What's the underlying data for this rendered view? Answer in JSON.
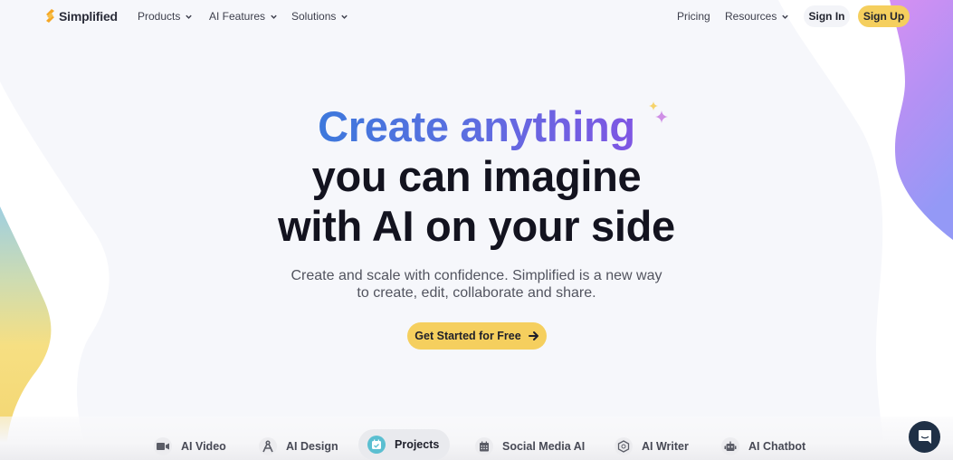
{
  "nav": {
    "logo_text": "Simplified",
    "menu": [
      {
        "label": "Products",
        "has_dropdown": true
      },
      {
        "label": "AI Features",
        "has_dropdown": true
      },
      {
        "label": "Solutions",
        "has_dropdown": true
      }
    ],
    "right_menu": [
      {
        "label": "Pricing",
        "has_dropdown": false
      },
      {
        "label": "Resources",
        "has_dropdown": true
      }
    ],
    "sign_in_label": "Sign In",
    "sign_up_label": "Sign Up"
  },
  "hero": {
    "headline_line1": "Create anything",
    "headline_line2": "you can imagine",
    "headline_line3": "with AI on your side",
    "subtitle_line1": "Create and scale with confidence. Simplified is a new way",
    "subtitle_line2": "to create, edit, collaborate and share.",
    "cta_label": "Get Started for Free",
    "cta_icon": "arrow-right-icon"
  },
  "tabs": [
    {
      "label": "AI Video",
      "icon": "video-camera-icon",
      "active": false
    },
    {
      "label": "AI Design",
      "icon": "compass-icon",
      "active": false
    },
    {
      "label": "Projects",
      "icon": "calendar-check-icon",
      "active": true
    },
    {
      "label": "Social Media AI",
      "icon": "calendar-icon",
      "active": false
    },
    {
      "label": "AI Writer",
      "icon": "hexagon-icon",
      "active": false
    },
    {
      "label": "AI Chatbot",
      "icon": "robot-icon",
      "active": false
    }
  ],
  "chat_widget": {
    "icon": "chat-icon"
  },
  "colors": {
    "brand_yellow": "#f5cf5e",
    "headline_gradient_start": "#3d78dc",
    "headline_gradient_end": "#7f56e3",
    "active_tab_icon": "#5bbfd1",
    "chat_widget_bg": "#1f3046",
    "page_bg": "#f6f7fb"
  }
}
